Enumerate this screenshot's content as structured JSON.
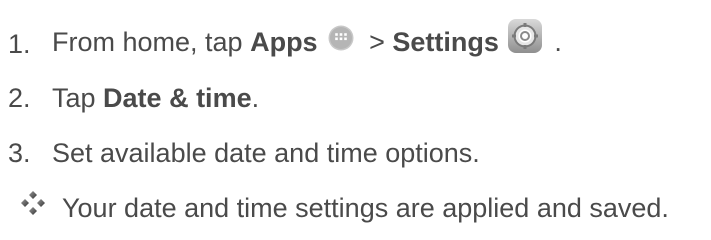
{
  "steps": [
    {
      "number": "1.",
      "parts": {
        "text1": "From home, tap ",
        "bold1": "Apps",
        "sep": " > ",
        "bold2": "Settings",
        "end": " ."
      }
    },
    {
      "number": "2.",
      "parts": {
        "text1": "Tap ",
        "bold1": "Date & time",
        "end": "."
      }
    },
    {
      "number": "3.",
      "parts": {
        "text1": "Set available date and time options."
      }
    }
  ],
  "result": {
    "text": "Your date and time settings are applied and saved."
  },
  "icons": {
    "apps": "apps-grid-icon",
    "settings": "settings-gear-icon",
    "result_bullet": "diamond-bullet-icon"
  },
  "colors": {
    "text": "#4a4a4a"
  }
}
